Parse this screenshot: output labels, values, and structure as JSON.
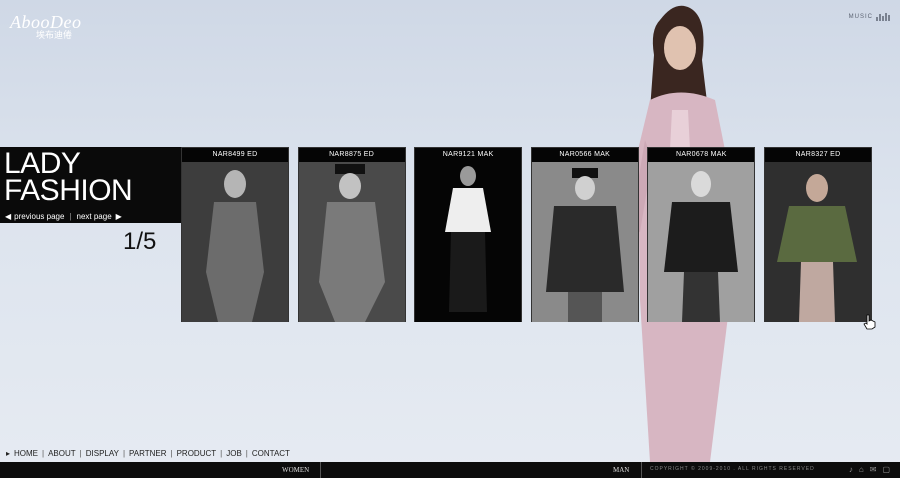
{
  "brand": {
    "name": "AbooDeo",
    "name_cn": "埃布迪倦"
  },
  "music_label": "MUSIC",
  "hero": {
    "title_line1": "LADY",
    "title_line2": "FASHION"
  },
  "pager": {
    "previous": "previous page",
    "next": "next page",
    "current": "1/5"
  },
  "cards": [
    {
      "code": "NAR8499 ED"
    },
    {
      "code": "NAR8875 ED"
    },
    {
      "code": "NAR9121 MAK"
    },
    {
      "code": "NAR0566 MAK"
    },
    {
      "code": "NAR0678 MAK"
    },
    {
      "code": "NAR8327 ED"
    }
  ],
  "footer_nav": [
    "HOME",
    "ABOUT",
    "DISPLAY",
    "PARTNER",
    "PRODUCT",
    "JOB",
    "CONTACT"
  ],
  "bottom_bar": {
    "women": "WOMEN",
    "man": "MAN",
    "copyright": "COPYRIGHT © 2009-2010 . ALL RIGHTS RESERVED"
  },
  "colors": {
    "background": "#dde4ee",
    "panel": "#0a0a0a",
    "accent_outfit": "#d9b8c4"
  }
}
